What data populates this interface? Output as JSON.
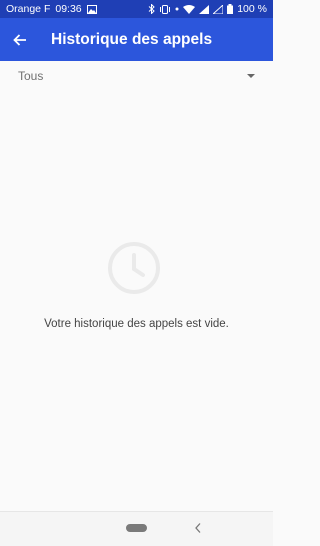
{
  "status_bar": {
    "carrier": "Orange F",
    "time": "09:36",
    "battery": "100 %",
    "icons": [
      "image-icon",
      "bluetooth-icon",
      "vibrate-icon",
      "wifi-icon",
      "signal-icon",
      "signal-icon",
      "battery-icon"
    ]
  },
  "app_bar": {
    "title": "Historique des appels",
    "back_icon": "arrow-left-icon"
  },
  "filter": {
    "selected": "Tous"
  },
  "empty_state": {
    "icon": "clock-icon",
    "message": "Votre historique des appels est vide."
  },
  "nav_bar": {
    "home_icon": "home-pill",
    "back_icon": "chevron-left-icon"
  },
  "colors": {
    "status_bar": "#1f3fb5",
    "app_bar": "#2c56dc",
    "background": "#fafafa"
  }
}
